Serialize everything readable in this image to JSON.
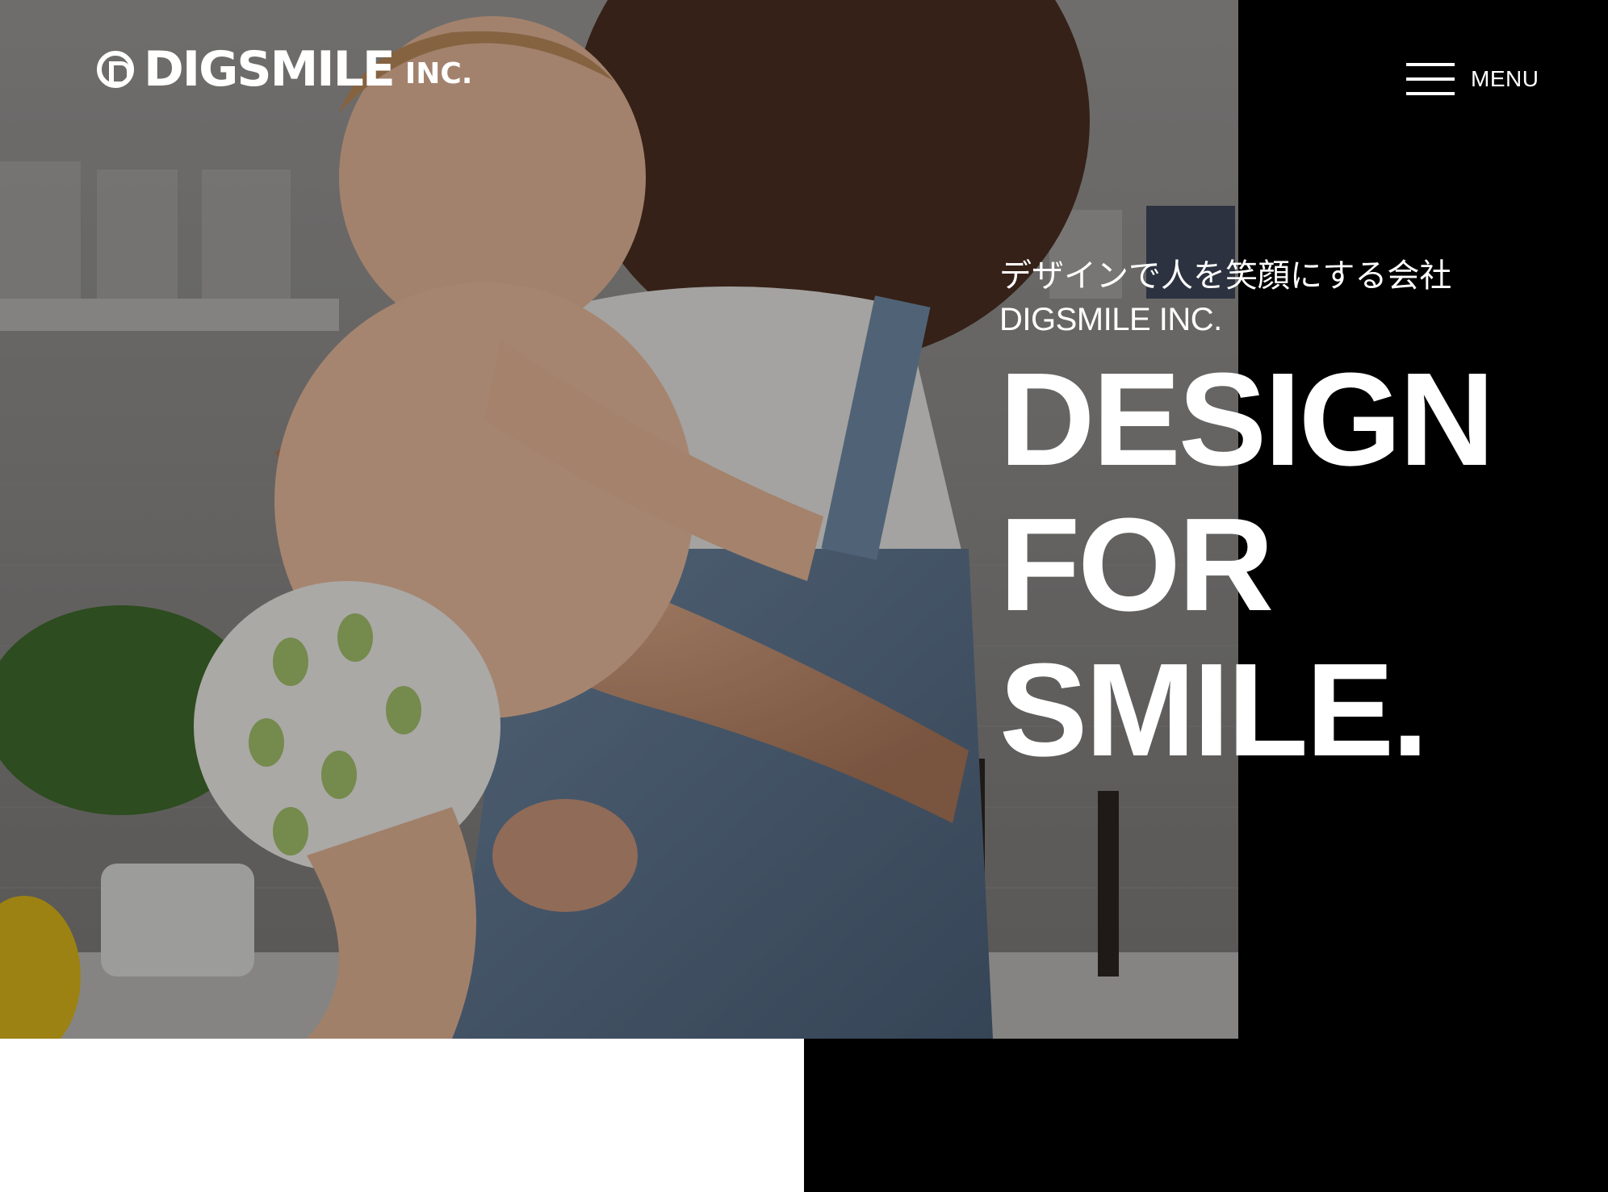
{
  "header": {
    "logo_name": "DIGSMILE",
    "logo_suffix": "INC.",
    "menu_label": "MENU"
  },
  "hero": {
    "tagline_jp": "デザインで人を笑顔にする会社",
    "tagline_en": "DIGSMILE INC.",
    "headline_lines": [
      "DESIGN",
      "FOR",
      "SMILE."
    ],
    "image_subject": "mother-holding-smiling-baby-photo"
  },
  "colors": {
    "background": "#ffffff",
    "panel": "#000000",
    "text_on_dark": "#ffffff"
  }
}
